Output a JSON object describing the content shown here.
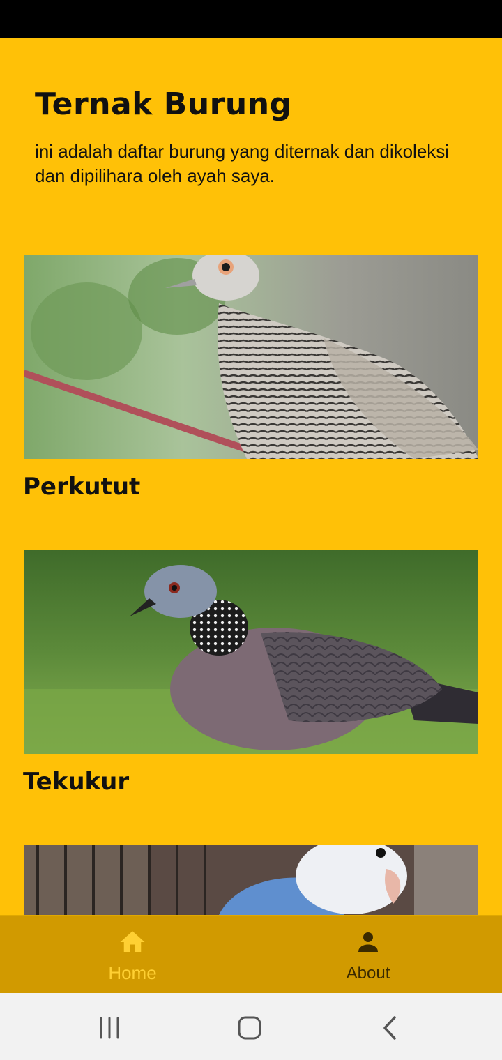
{
  "header": {
    "title": "Ternak Burung",
    "description": "ini adalah daftar burung yang diternak dan dikoleksi dan dipilihara oleh ayah saya."
  },
  "birds": [
    {
      "name": "Perkutut"
    },
    {
      "name": "Tekukur"
    },
    {
      "name": ""
    }
  ],
  "bottom_nav": {
    "items": [
      {
        "label": "Home",
        "icon": "home-icon",
        "active": true
      },
      {
        "label": "About",
        "icon": "person-icon",
        "active": false
      }
    ]
  },
  "colors": {
    "background": "#FFC107",
    "nav_background": "#D19A00",
    "nav_active": "#FFD033",
    "nav_inactive": "#3a2a00"
  }
}
